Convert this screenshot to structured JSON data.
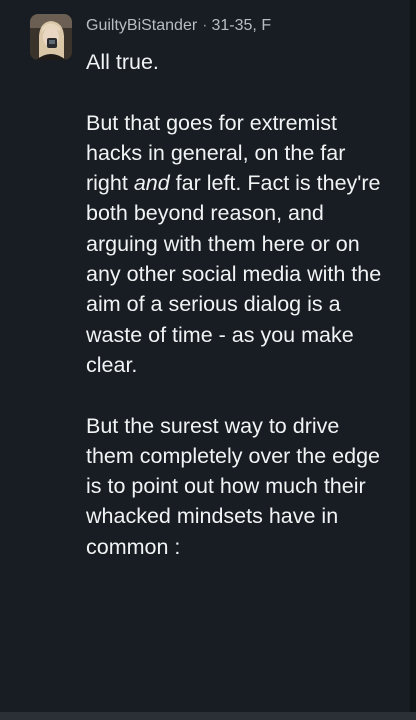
{
  "comment": {
    "author": "GuiltyBiStander",
    "separator": "·",
    "meta": "31-35, F",
    "paragraphs": [
      [
        "All true."
      ],
      [
        "But that goes for extremist hacks in general, on the far right ",
        "and",
        " far left. Fact is they're both beyond reason, and arguing with them here or on any other social media with the aim of a serious dialog is a waste of time - as you make clear."
      ],
      [
        "But the surest way to drive them completely over the edge is to point out how much their whacked mindsets have in common :"
      ]
    ]
  },
  "icons": {
    "avatar": "profile-photo-icon"
  }
}
